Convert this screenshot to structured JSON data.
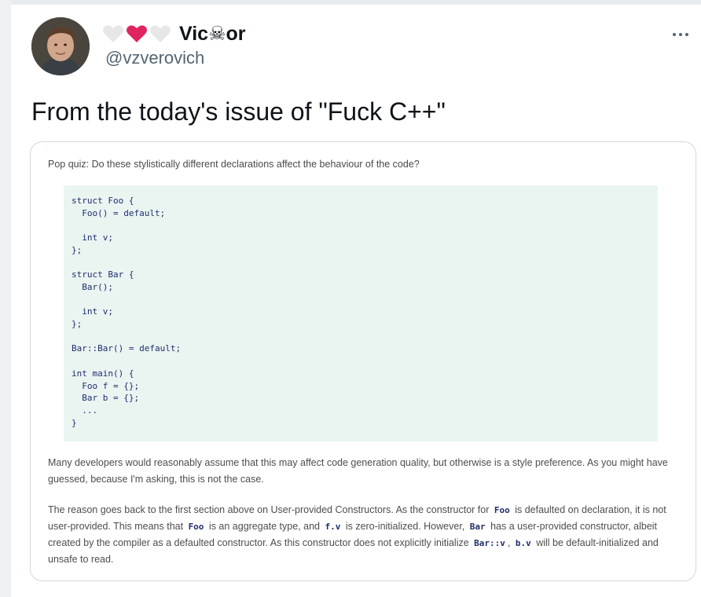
{
  "tweet": {
    "display_name": "Vic☠or",
    "handle": "@vzverovich",
    "text": "From the today's issue of \"Fuck C++\"",
    "name_hearts": [
      "white-heart",
      "red-heart",
      "white-heart"
    ]
  },
  "card": {
    "question": "Pop quiz: Do these stylistically different declarations affect the behaviour of the code?",
    "code_lines": [
      "struct Foo {",
      "  Foo() = default;",
      "",
      "  int v;",
      "};",
      "",
      "struct Bar {",
      "  Bar();",
      "",
      "  int v;",
      "};",
      "",
      "Bar::Bar() = default;",
      "",
      "int main() {",
      "  Foo f = {};",
      "  Bar b = {};",
      "  ...",
      "}"
    ],
    "para1": "Many developers would reasonably assume that this may affect code generation quality, but otherwise is a style preference. As you might have guessed, because I'm asking, this is not the case.",
    "para2": {
      "t1": "The reason goes back to the first section above on User-provided Constructors. As the constructor for ",
      "c1": "Foo",
      "t2": " is defaulted on declaration, it is not user-provided. This means that ",
      "c2": "Foo",
      "t3": " is an aggregate type, and ",
      "c3": "f.v",
      "t4": " is zero-initialized. However, ",
      "c4": "Bar",
      "t5": " has a user-provided constructor, albeit created by the compiler as a defaulted constructor. As this constructor does not explicitly initialize ",
      "c5": "Bar::v",
      "t6": ", ",
      "c6": "b.v",
      "t7": " will be default-initialized and unsafe to read."
    }
  },
  "colors": {
    "red_heart": "#f91880",
    "white_heart": "#e7e7e7",
    "code_bg": "#eaf5f2",
    "code_text": "#1f2d6b"
  }
}
